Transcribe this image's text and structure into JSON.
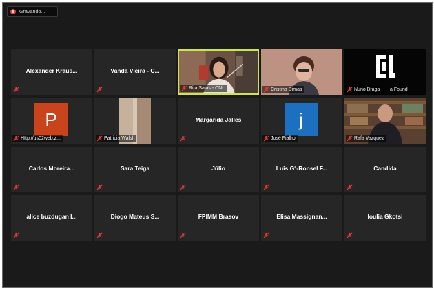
{
  "recording": {
    "label": "Gravando..."
  },
  "colors": {
    "active_speaker": "#cde64a",
    "muted": "#e03c3c"
  },
  "participants": [
    {
      "name": "Alexander Kraus...",
      "muted": true
    },
    {
      "name": "Vanda Vieira - C...",
      "muted": true
    },
    {
      "label": "Rita Saias - CNU",
      "muted": true,
      "active_speaker": true,
      "type": "video"
    },
    {
      "label": "Cristina Dimas",
      "muted": true,
      "type": "video"
    },
    {
      "label": "Nuno Braga",
      "overlay_text": "a Found",
      "muted": true,
      "type": "logo"
    },
    {
      "label": "Http://us02web.z...",
      "avatar_letter": "P",
      "avatar_color": "#c9431d",
      "muted": true
    },
    {
      "label": "Patricia Walsh",
      "muted": true,
      "type": "video"
    },
    {
      "name": "Margarida Jalles",
      "muted": true
    },
    {
      "label": "José Fialho",
      "avatar_letter": "j",
      "avatar_color": "#1d6fbf",
      "muted": true
    },
    {
      "label": "Rafa Vazquez",
      "muted": true,
      "type": "video"
    },
    {
      "name": "Carlos  Moreira...",
      "muted": true
    },
    {
      "name": "Sara Teiga",
      "muted": true
    },
    {
      "name": "Júlio",
      "muted": true
    },
    {
      "name": "Luis Gª-Ronsel F...",
      "muted": true
    },
    {
      "name": "Candida",
      "muted": true
    },
    {
      "name": "alice buzdugan I...",
      "muted": true
    },
    {
      "name": "Diogo Mateus S...",
      "muted": true
    },
    {
      "name": "FPIMM Brasov",
      "muted": true
    },
    {
      "name": "Elisa  Massignan...",
      "muted": true
    },
    {
      "name": "Ioulia Gkotsi",
      "muted": true
    }
  ]
}
